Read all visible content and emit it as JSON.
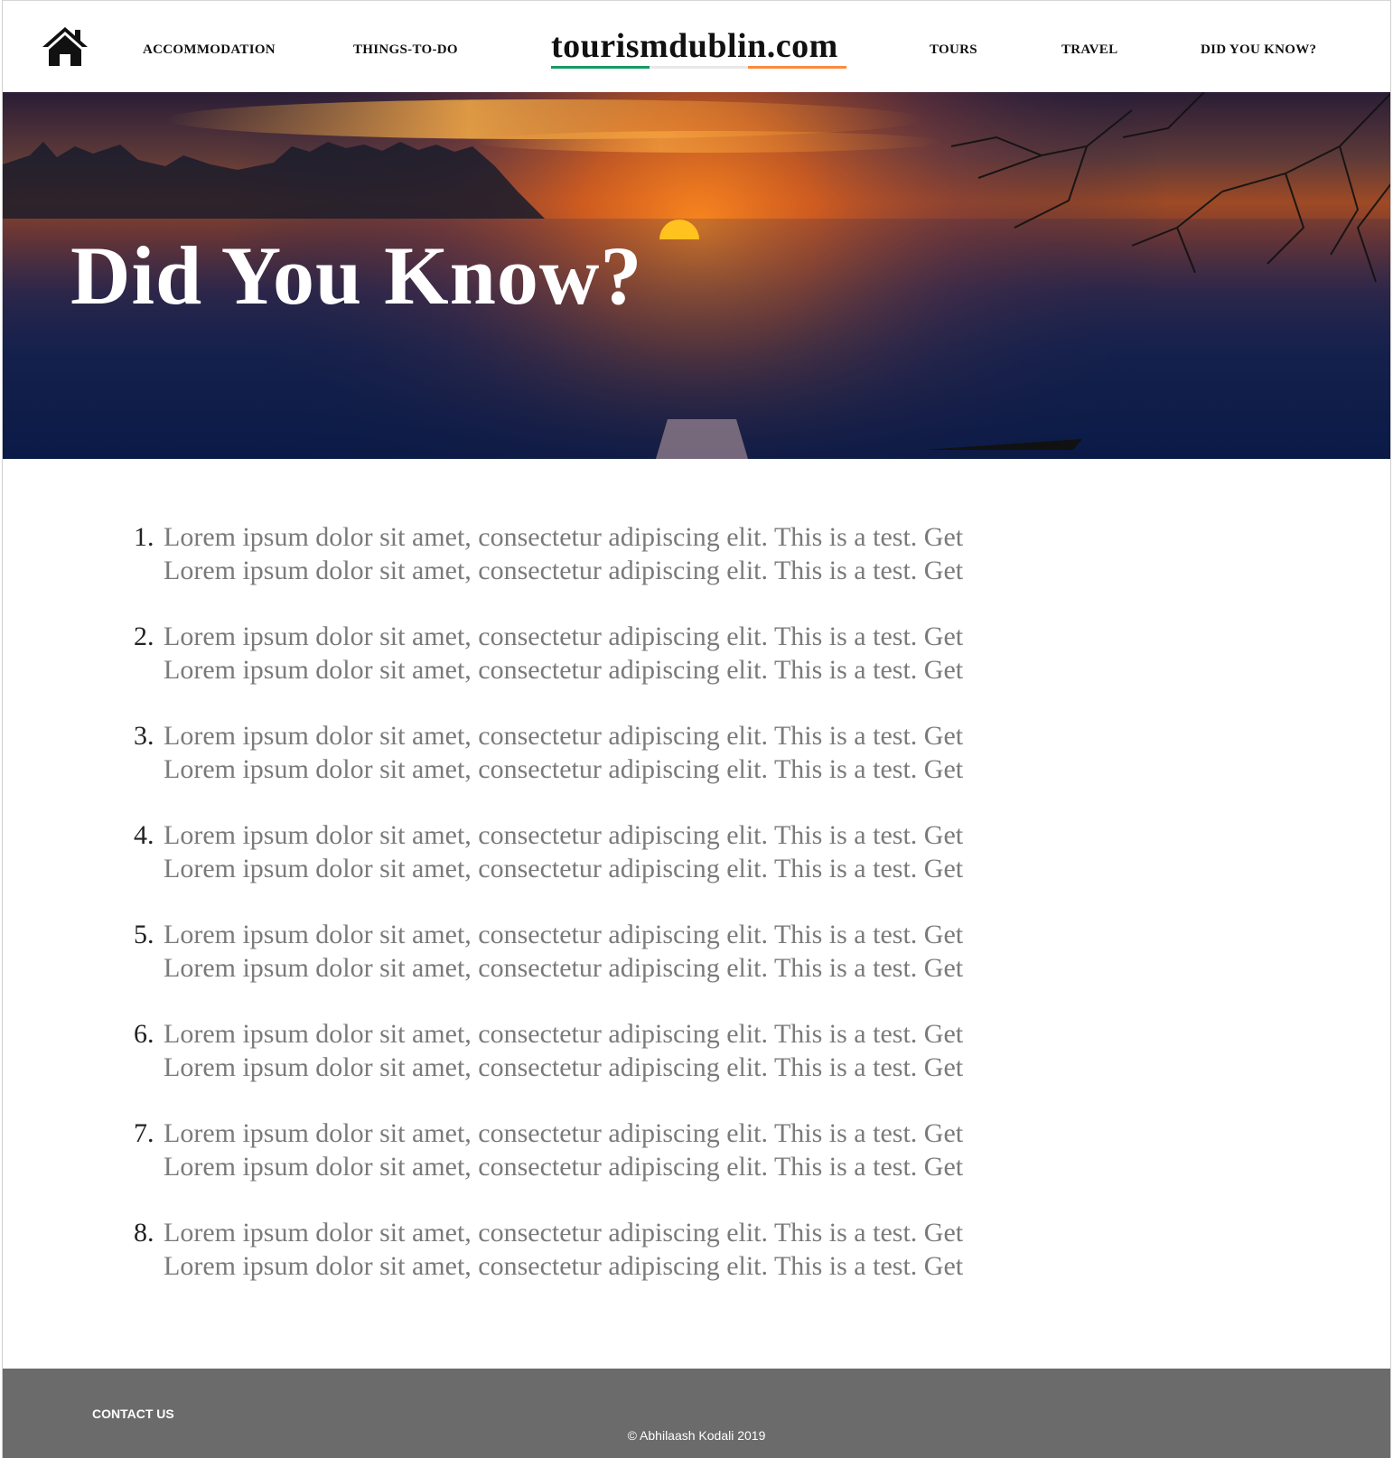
{
  "nav": {
    "home_icon": "home-icon",
    "links": [
      {
        "label": "ACCOMMODATION"
      },
      {
        "label": "THINGS-TO-DO"
      },
      {
        "label": "TOURS"
      },
      {
        "label": "TRAVEL"
      },
      {
        "label": "DID YOU KNOW?"
      }
    ],
    "brand": "tourismdublin.com",
    "brand_colors": [
      "#169b62",
      "#e8e8e8",
      "#ff883e"
    ]
  },
  "hero": {
    "title": "Did You Know?"
  },
  "facts": [
    {
      "num": "1.",
      "line1": "Lorem ipsum dolor sit amet, consectetur adipiscing elit. This is a test. Get",
      "line2": "Lorem ipsum dolor sit amet, consectetur adipiscing elit. This is a test. Get"
    },
    {
      "num": "2.",
      "line1": "Lorem ipsum dolor sit amet, consectetur adipiscing elit. This is a test. Get",
      "line2": "Lorem ipsum dolor sit amet, consectetur adipiscing elit. This is a test. Get"
    },
    {
      "num": "3.",
      "line1": "Lorem ipsum dolor sit amet, consectetur adipiscing elit. This is a test. Get",
      "line2": "Lorem ipsum dolor sit amet, consectetur adipiscing elit. This is a test. Get"
    },
    {
      "num": "4.",
      "line1": "Lorem ipsum dolor sit amet, consectetur adipiscing elit. This is a test. Get",
      "line2": "Lorem ipsum dolor sit amet, consectetur adipiscing elit. This is a test. Get"
    },
    {
      "num": "5.",
      "line1": "Lorem ipsum dolor sit amet, consectetur adipiscing elit. This is a test. Get",
      "line2": "Lorem ipsum dolor sit amet, consectetur adipiscing elit. This is a test. Get"
    },
    {
      "num": "6.",
      "line1": "Lorem ipsum dolor sit amet, consectetur adipiscing elit. This is a test. Get",
      "line2": "Lorem ipsum dolor sit amet, consectetur adipiscing elit. This is a test. Get"
    },
    {
      "num": "7.",
      "line1": "Lorem ipsum dolor sit amet, consectetur adipiscing elit. This is a test. Get",
      "line2": "Lorem ipsum dolor sit amet, consectetur adipiscing elit. This is a test. Get"
    },
    {
      "num": "8.",
      "line1": "Lorem ipsum dolor sit amet, consectetur adipiscing elit. This is a test. Get",
      "line2": "Lorem ipsum dolor sit amet, consectetur adipiscing elit. This is a test. Get"
    }
  ],
  "footer": {
    "contact": "CONTACT US",
    "copyright": "© Abhilaash Kodali 2019",
    "background": "#6b6b6b"
  }
}
